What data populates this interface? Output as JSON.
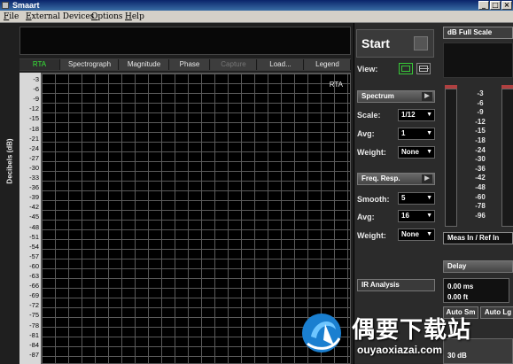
{
  "window": {
    "title": "Smaart"
  },
  "menu": {
    "items": [
      {
        "label": "File",
        "u": "F",
        "rest": "ile"
      },
      {
        "label": "External Devices",
        "u": "E",
        "rest": "xternal Devices"
      },
      {
        "label": "Options",
        "u": "O",
        "rest": "ptions"
      },
      {
        "label": "Help",
        "u": "H",
        "rest": "elp"
      }
    ]
  },
  "tabs": [
    "RTA",
    "Spectrograph",
    "Magnitude",
    "Phase",
    "Capture",
    "Load...",
    "Legend"
  ],
  "plot": {
    "ylabel": "Decibels (dB)",
    "mode_label": "RTA",
    "yticks": [
      "-3",
      "-6",
      "-9",
      "-12",
      "-15",
      "-18",
      "-21",
      "-24",
      "-27",
      "-30",
      "-33",
      "-36",
      "-39",
      "-42",
      "-45",
      "-48",
      "-51",
      "-54",
      "-57",
      "-60",
      "-63",
      "-66",
      "-69",
      "-72",
      "-75",
      "-78",
      "-81",
      "-84",
      "-87"
    ]
  },
  "controls": {
    "start": "Start",
    "view": "View:",
    "spectrum": "Spectrum",
    "scale_label": "Scale:",
    "scale_value": "1/12",
    "avg_label": "Avg:",
    "avg_value": "1",
    "weight_label": "Weight:",
    "weight_value": "None",
    "freq_resp": "Freq. Resp.",
    "smooth_label": "Smooth:",
    "smooth_value": "5",
    "avg2_label": "Avg:",
    "avg2_value": "16",
    "weight2_label": "Weight:",
    "weight2_value": "None",
    "ir_analysis": "IR Analysis"
  },
  "right": {
    "full_scale": "dB Full Scale",
    "meter_ticks": [
      "-3",
      "-6",
      "-9",
      "-12",
      "-15",
      "-18",
      "-24",
      "-30",
      "-36",
      "-42",
      "-48",
      "-60",
      "-78",
      "-96"
    ],
    "meas": "Meas In / Ref In",
    "delay": "Delay",
    "delay_ms": "0.00 ms",
    "delay_ft": "0.00 ft",
    "auto_sm": "Auto Sm",
    "auto_lg": "Auto Lg",
    "low_value": "30 dB"
  },
  "watermark": {
    "title": "偶要下载站",
    "url": "ouyaoxiazai.com"
  }
}
